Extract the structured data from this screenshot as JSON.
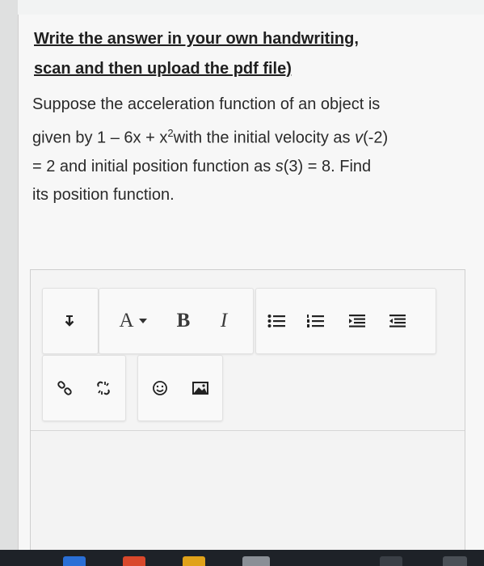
{
  "instructions": {
    "line1": "Write the answer in your own handwriting,",
    "line2": "scan and then upload the pdf file)"
  },
  "question": {
    "l1": "Suppose the acceleration function of an object is",
    "l2_a": "given by 1 – 6x + x",
    "l2_sup": "2",
    "l2_b": "with the initial velocity as ",
    "l2_v": "v",
    "l2_c": "(-2)",
    "l3_a": "= 2 and initial position function as ",
    "l3_s": "s",
    "l3_b": "(3) = 8. Find",
    "l4": "its position function."
  },
  "toolbar": {
    "font_label": "A",
    "bold_label": "B",
    "italic_label": "I",
    "icons": [
      "paragraph-style-icon",
      "font-color-icon",
      "bold-icon",
      "italic-icon",
      "bullet-list-icon",
      "numbered-list-icon",
      "align-center-icon",
      "align-justify-icon",
      "link-icon",
      "unlink-icon",
      "emoji-icon",
      "image-icon"
    ]
  },
  "colors": {
    "background": "#f7f7f7",
    "text": "#1f1f1f",
    "toolbar_group": "#f9f9f9",
    "taskbar": "#1e2228"
  }
}
